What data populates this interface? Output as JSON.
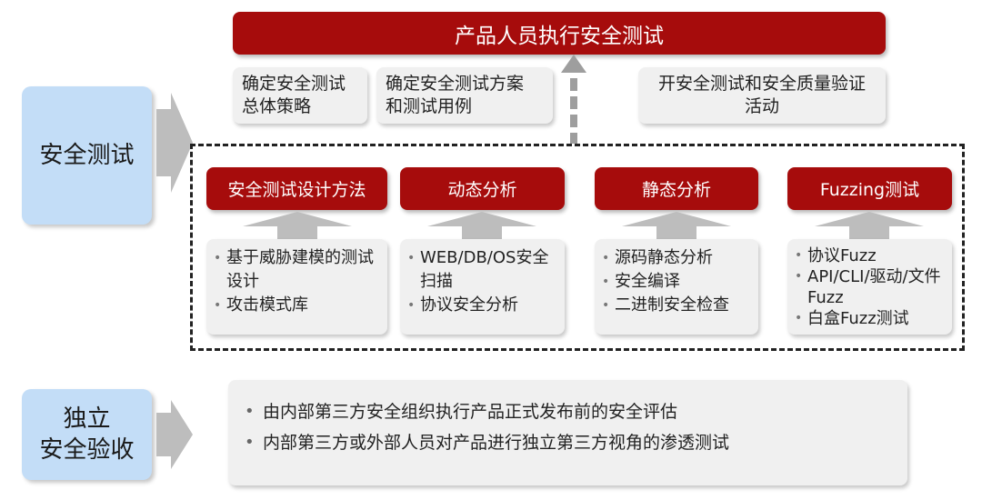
{
  "top_title": "产品人员执行安全测试",
  "top_boxes": [
    {
      "text": [
        "确定安全测试",
        "总体策略"
      ]
    },
    {
      "text": [
        "确定安全测试方案",
        "和测试用例"
      ]
    },
    {
      "text": [
        "开安全测试和安全质量验证",
        "活动"
      ]
    }
  ],
  "left_labels": {
    "security_testing": [
      "安全测试"
    ],
    "independent": [
      "独立",
      "安全验收"
    ]
  },
  "methods": [
    {
      "title": "安全测试设计方法",
      "items": [
        "基于威胁建模的测试设计",
        "攻击模式库"
      ]
    },
    {
      "title": "动态分析",
      "items": [
        "WEB/DB/OS安全扫描",
        "协议安全分析"
      ]
    },
    {
      "title": "静态分析",
      "items": [
        "源码静态分析",
        "安全编译",
        "二进制安全检查"
      ]
    },
    {
      "title": "Fuzzing测试",
      "items": [
        "协议Fuzz",
        "API/CLI/驱动/文件Fuzz",
        "白盒Fuzz测试"
      ]
    }
  ],
  "independent_items": [
    "由内部第三方安全组织执行产品正式发布前的安全评估",
    "内部第三方或外部人员对产品进行独立第三方视角的渗透测试"
  ],
  "colors": {
    "red": "#a60c0c",
    "blue": "#c3ddf7",
    "grey_box": "#f0f0f0",
    "arrow_grey": "#bdbdbd"
  }
}
